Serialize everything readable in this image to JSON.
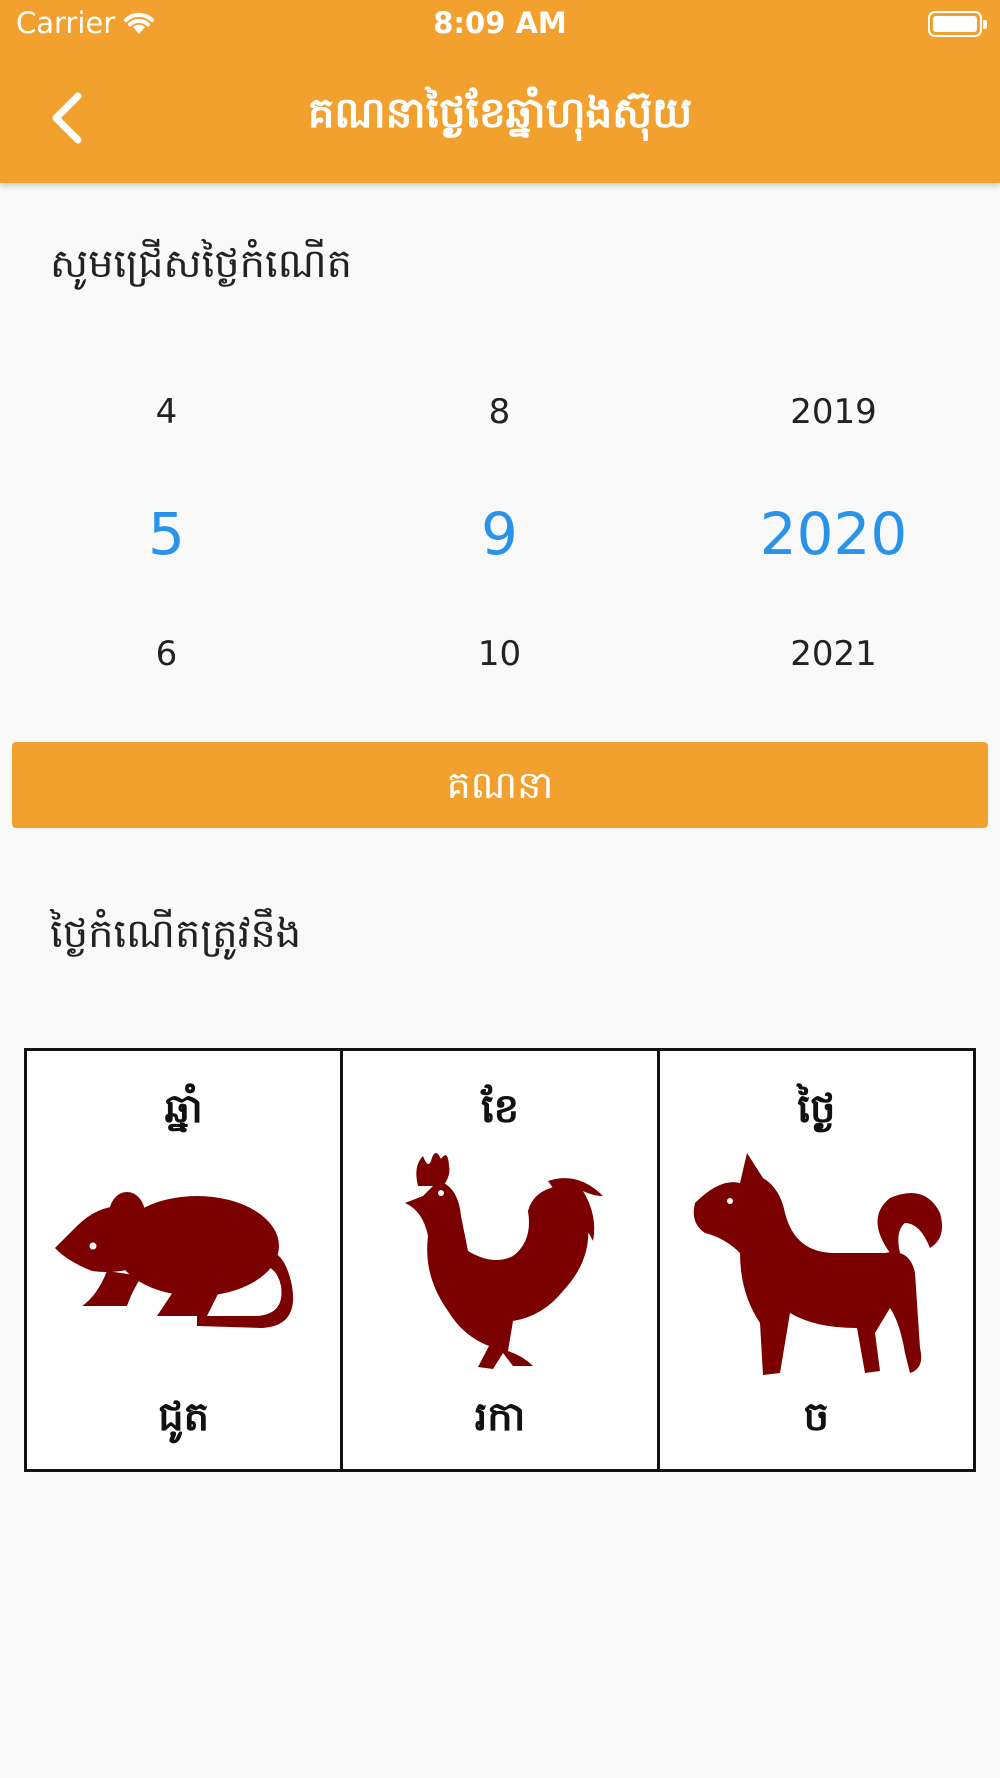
{
  "status_bar": {
    "carrier": "Carrier",
    "time": "8:09 AM"
  },
  "header": {
    "title": "គណនាថ្ងៃខែឆ្នាំហុងស៊ុយ",
    "back_icon": "chevron-left-icon"
  },
  "birthdate_section": {
    "label": "សូមជ្រើសថ្ងៃកំណើត"
  },
  "picker": {
    "day": {
      "prev": "4",
      "selected": "5",
      "next": "6"
    },
    "month": {
      "prev": "8",
      "selected": "9",
      "next": "10"
    },
    "year": {
      "prev": "2019",
      "selected": "2020",
      "next": "2021"
    }
  },
  "calculate_button": {
    "label": "គណនា"
  },
  "result_section": {
    "label": "ថ្ងៃកំណើតត្រូវនឹង"
  },
  "results": [
    {
      "heading": "ឆ្នាំ",
      "animal": "ជូត",
      "icon": "rat-icon"
    },
    {
      "heading": "ខែ",
      "animal": "រកា",
      "icon": "rooster-icon"
    },
    {
      "heading": "ថ្ងៃ",
      "animal": "ច",
      "icon": "dog-icon"
    }
  ],
  "colors": {
    "accent": "#f2a12f",
    "selected": "#2893e8",
    "animal": "#7b0000"
  }
}
